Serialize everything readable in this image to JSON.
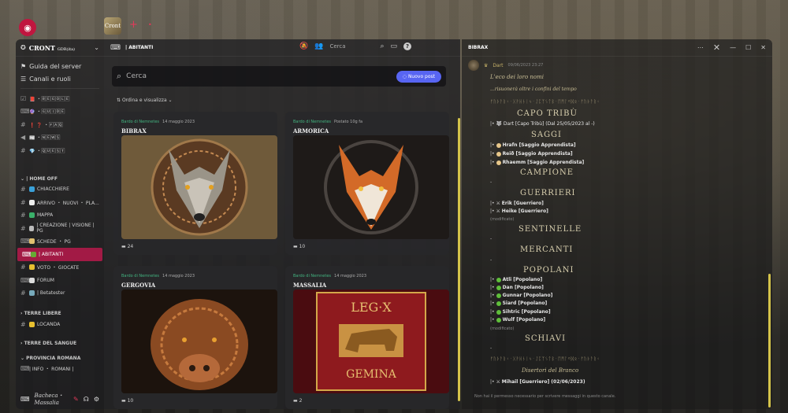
{
  "topbar": {
    "app_icon": "discord-icon",
    "server_tab_label": "Cront",
    "add_tab": "+"
  },
  "sidebar": {
    "server_name": "CRONT",
    "server_suffix": "GDR(ita)",
    "links": [
      {
        "label": "Guida del server",
        "icon": "signpost-icon"
      },
      {
        "label": "Canali e ruoli",
        "icon": "list-icon"
      }
    ],
    "channels_top": [
      {
        "icon": "checkbox-icon",
        "label": "📕 ・🅁🄴🄶🄾🄻🄴"
      },
      {
        "icon": "forum-icon",
        "label": "🔮 ・🄶🅄🄸🄳🄴"
      },
      {
        "icon": "hash-icon",
        "label": "❗ ❓ ・🄵🄰🅀"
      },
      {
        "icon": "megaphone-icon",
        "label": "📰 ・🄽🄴🅆🅂"
      },
      {
        "icon": "hash-icon",
        "label": "💎 ・🅀🅄🄴🅂🅃"
      }
    ],
    "category_home": "| HOME OFF",
    "channels_home": [
      {
        "icon": "hash-icon",
        "label": "CHIACCHIERE",
        "active": false
      },
      {
        "icon": "hash-icon",
        "label": "ARRIVO ・ NUOVI ・ PLA...",
        "active": false
      },
      {
        "icon": "hash-icon",
        "label": "MAPPA",
        "active": false
      },
      {
        "icon": "hash-icon",
        "label": "| CREAZIONE | VISIONE | PG",
        "active": false
      },
      {
        "icon": "forum-icon",
        "label": "SCHEDE ・ PG",
        "active": false
      },
      {
        "icon": "forum-icon",
        "label": "| ABITANTI",
        "active": true
      },
      {
        "icon": "hash-icon",
        "label": "VOTO ・ GIOCATE",
        "active": false
      },
      {
        "icon": "forum-icon",
        "label": "FORUM",
        "active": false
      },
      {
        "icon": "hash-icon",
        "label": "| Betatester",
        "active": false
      }
    ],
    "category_terre_libere": "TERRE LIBERE",
    "channel_locanda": "LOCANDA",
    "category_sangue": "TERRE DEL SANGUE",
    "category_roma": "PROVINCIA ROMANA",
    "channel_info_romani": "| INFO ・ ROMANI |",
    "footer_text": "Bacheca・Massalia"
  },
  "forum": {
    "title": "| ABITANTI",
    "search_placeholder": "Cerca",
    "header_search": "Cerca",
    "new_post": "Nuovo post",
    "sort_label": "Ordina e visualizza",
    "cards": [
      {
        "author": "Bardo di Nemnetes",
        "date": "14 maggio 2023",
        "extra": "",
        "title": "BIBRAX",
        "count": "24",
        "image": "wolf"
      },
      {
        "author": "Bardo di Nemnetes",
        "date": "",
        "extra": "Postato 10g fa",
        "title": "ARMORICA",
        "count": "10",
        "image": "fox"
      },
      {
        "author": "Bardo di Nemnetes",
        "date": "14 maggio 2023",
        "extra": "",
        "title": "GERGOVIA",
        "count": "10",
        "image": "boar"
      },
      {
        "author": "Bardo di Nemnetes",
        "date": "14 maggio 2023",
        "extra": "",
        "title": "MASSALIA",
        "count": "2",
        "image": "legion"
      }
    ],
    "legion_top": "LEG·X",
    "legion_bottom": "GEMINA"
  },
  "thread": {
    "title": "BIBRAX",
    "author": "Dart",
    "timestamp": "09/06/2023 23:27",
    "intro": "L'eco dei loro nomi",
    "intro2": "...risuonerà oltre i confini del tempo",
    "runes": "ᚠᚢᚦᚨᚱᚲ᛫ᚷᚹᚺᚾᛁᛃ᛫ᛇᛈᛉᛊᛏᛒ᛫ᛖᛗᛚᛜᛞᛟ᛫ᚠᚢᚦᚨᚱᚲ",
    "sections": {
      "capo": "CAPO TRIBÙ",
      "saggi": "SAGGI",
      "campione": "CAMPIONE",
      "guerrieri": "GUERRIERI",
      "sentinelle": "SENTINELLE",
      "mercanti": "MERCANTI",
      "popolani": "POPOLANI",
      "schiavi": "SCHIAVI"
    },
    "capo_entry": "Dart [Capo Tribù] (Dal 25/05/2023 al -)",
    "saggi_entries": [
      "Hrafn [Saggio Apprendista]",
      "Reið [Saggio Apprendista]",
      "Rhaemm [Saggio Apprendista]"
    ],
    "guerrieri_entries": [
      "Erik [Guerriero]",
      "Heike [Guerriero]"
    ],
    "popolani_entries": [
      "Atli [Popolano]",
      "Dan [Popolano]",
      "Gunnar [Popolano]",
      "Siard [Popolano]",
      "Sihtric [Popolano]",
      "Wulf [Popolano]"
    ],
    "modified": "(modificato)",
    "dash": "-",
    "disertori": "Disertori del Branco",
    "disertori_entry": "Mihail [Guerriero] (02/06/2023)",
    "input_placeholder": "Non hai il permesso necessario per scrivere messaggi in questo canale."
  },
  "colors": {
    "active_channel": "#b9194b",
    "accent": "#5865f2",
    "scroll": "#d4c34a"
  }
}
